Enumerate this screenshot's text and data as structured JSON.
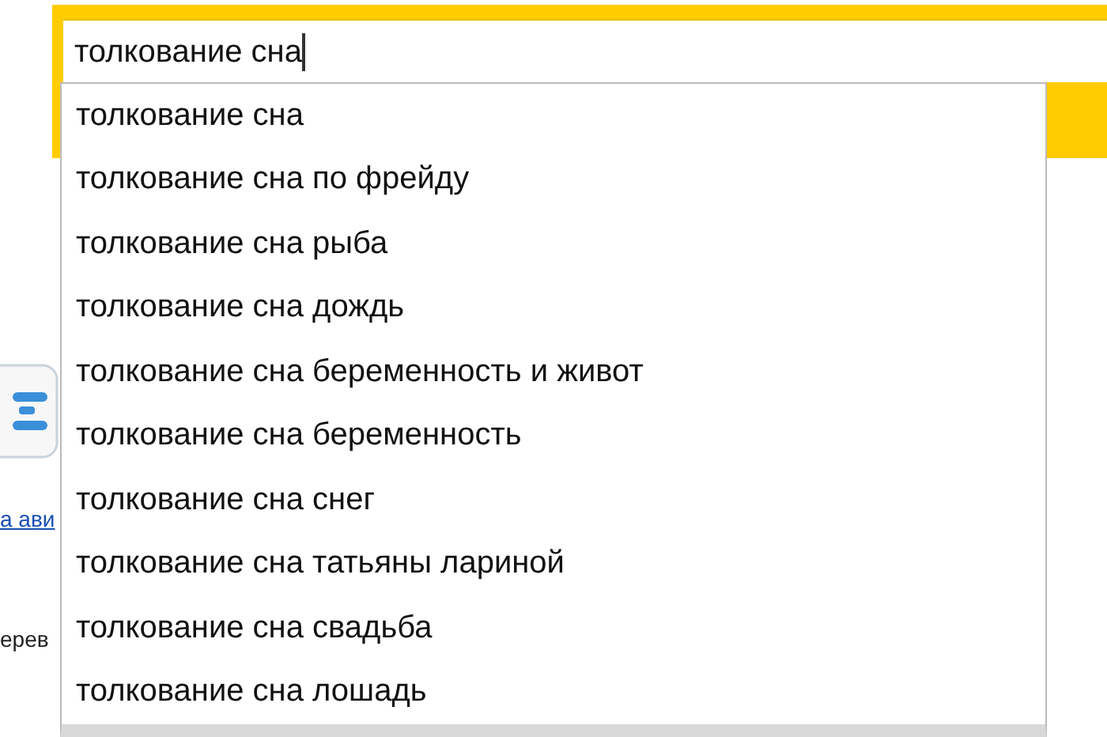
{
  "search": {
    "value": "толкование сна"
  },
  "suggestions": [
    {
      "text": "толкование сна"
    },
    {
      "text": "толкование сна по фрейду"
    },
    {
      "text": "толкование сна рыба"
    },
    {
      "text": "толкование сна дождь"
    },
    {
      "text": "толкование сна беременность и живот"
    },
    {
      "text": "толкование сна беременность"
    },
    {
      "text": "толкование сна снег"
    },
    {
      "text": "толкование сна татьяны лариной"
    },
    {
      "text": "толкование сна свадьба"
    },
    {
      "text": "толкование сна лошадь"
    }
  ],
  "page": {
    "link": "а ави",
    "text": "ерев"
  }
}
